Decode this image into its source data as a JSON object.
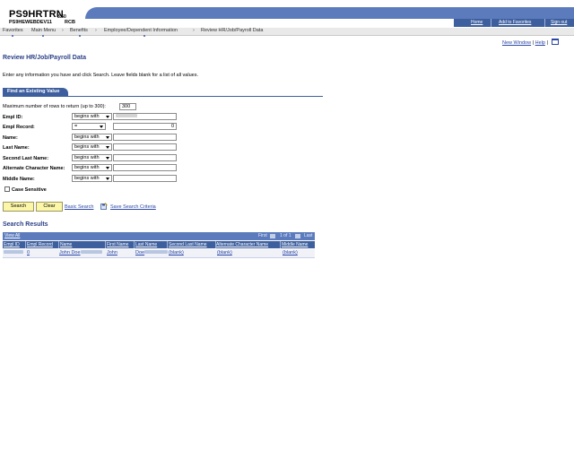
{
  "header": {
    "brand_title": "PS9HRTRN",
    "brand_version": "8.50",
    "brand_db": "PS9HEWEBDEV11",
    "brand_tag": "RCB",
    "util_links": [
      "Home",
      "Add to Favorites",
      "Sign out"
    ]
  },
  "breadcrumb": [
    "Favorites",
    "Main Menu",
    "Benefits",
    "Employee/Dependent Information",
    "Review HR/Job/Payroll Data"
  ],
  "top_links": {
    "new_window": "New Window",
    "sep": "|",
    "help": "Help"
  },
  "page": {
    "title": "Review HR/Job/Payroll Data",
    "instructions": "Enter any information you have and click Search. Leave fields blank for a list of all values."
  },
  "tab": {
    "label": "Find an Existing Value"
  },
  "form": {
    "max_rows_label": "Maximum number of rows to return (up to 300):",
    "max_rows_value": "300",
    "fields": [
      {
        "label": "Empl ID:",
        "operator": "begins with",
        "value": ""
      },
      {
        "label": "Empl Record:",
        "operator": "=",
        "value": "0"
      },
      {
        "label": "Name:",
        "operator": "begins with",
        "value": ""
      },
      {
        "label": "Last Name:",
        "operator": "begins with",
        "value": ""
      },
      {
        "label": "Second Last Name:",
        "operator": "begins with",
        "value": ""
      },
      {
        "label": "Alternate Character Name:",
        "operator": "begins with",
        "value": ""
      },
      {
        "label": "Middle Name:",
        "operator": "begins with",
        "value": ""
      }
    ],
    "case_sensitive_label": "Case Sensitive"
  },
  "buttons": {
    "search": "Search",
    "clear": "Clear",
    "basic_search": "Basic Search",
    "save_criteria": "Save Search Criteria"
  },
  "results": {
    "title": "Search Results",
    "view_all": "View All",
    "nav_first": "First",
    "nav_range": "1 of 1",
    "nav_last": "Last",
    "columns": [
      "Empl ID",
      "Empl Record",
      "Name",
      "First Name",
      "Last Name",
      "Second Last Name",
      "Alternate Character Name",
      "Middle Name"
    ],
    "row": {
      "empl_record": "0",
      "name": "John Doe",
      "first_name": "John",
      "last_name": "Doe",
      "second_last_name": "(blank)",
      "alt_char_name": "(blank)",
      "middle_name": "(blank)"
    }
  },
  "colors": {
    "header_blue": "#5b7bbd",
    "dark_blue": "#3e5f9e",
    "title_blue": "#2a3f86",
    "link_blue": "#2a46a6",
    "button_yellow": "#fcf7a8"
  }
}
